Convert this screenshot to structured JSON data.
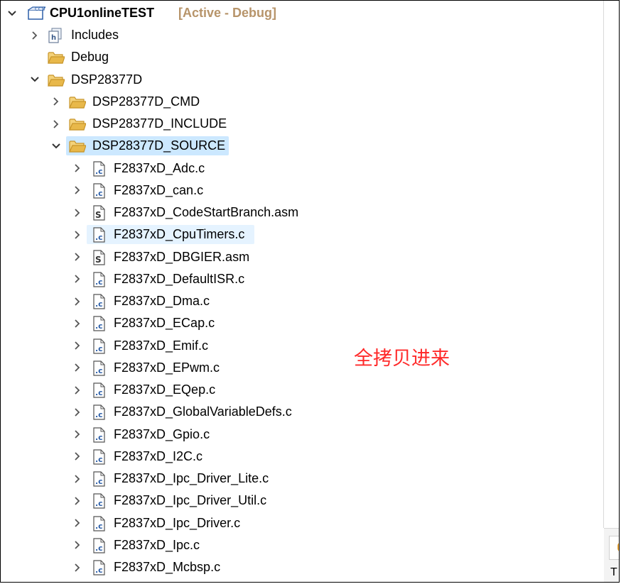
{
  "project": {
    "name": "CPU1onlineTEST",
    "state": "[Active - Debug]"
  },
  "tree": [
    {
      "label": "Includes",
      "icon": "includes-icon",
      "chevron": "collapsed",
      "depth": 1
    },
    {
      "label": "Debug",
      "icon": "folder-icon",
      "chevron": "none",
      "depth": 1
    },
    {
      "label": "DSP28377D",
      "icon": "folder-icon",
      "chevron": "expanded",
      "depth": 1
    },
    {
      "label": "DSP28377D_CMD",
      "icon": "folder-icon",
      "chevron": "collapsed",
      "depth": 2
    },
    {
      "label": "DSP28377D_INCLUDE",
      "icon": "folder-icon",
      "chevron": "collapsed",
      "depth": 2
    },
    {
      "label": "DSP28377D_SOURCE",
      "icon": "folder-icon",
      "chevron": "expanded",
      "depth": 2,
      "selected": "strong"
    },
    {
      "label": "F2837xD_Adc.c",
      "icon": "c-file-icon",
      "chevron": "collapsed",
      "depth": 3
    },
    {
      "label": "F2837xD_can.c",
      "icon": "c-file-icon",
      "chevron": "collapsed",
      "depth": 3
    },
    {
      "label": "F2837xD_CodeStartBranch.asm",
      "icon": "asm-file-icon",
      "chevron": "collapsed",
      "depth": 3
    },
    {
      "label": "F2837xD_CpuTimers.c",
      "icon": "c-file-icon",
      "chevron": "collapsed",
      "depth": 3,
      "selected": "light"
    },
    {
      "label": "F2837xD_DBGIER.asm",
      "icon": "asm-file-icon",
      "chevron": "collapsed",
      "depth": 3
    },
    {
      "label": "F2837xD_DefaultISR.c",
      "icon": "c-file-icon",
      "chevron": "collapsed",
      "depth": 3
    },
    {
      "label": "F2837xD_Dma.c",
      "icon": "c-file-icon",
      "chevron": "collapsed",
      "depth": 3
    },
    {
      "label": "F2837xD_ECap.c",
      "icon": "c-file-icon",
      "chevron": "collapsed",
      "depth": 3
    },
    {
      "label": "F2837xD_Emif.c",
      "icon": "c-file-icon",
      "chevron": "collapsed",
      "depth": 3
    },
    {
      "label": "F2837xD_EPwm.c",
      "icon": "c-file-icon",
      "chevron": "collapsed",
      "depth": 3
    },
    {
      "label": "F2837xD_EQep.c",
      "icon": "c-file-icon",
      "chevron": "collapsed",
      "depth": 3
    },
    {
      "label": "F2837xD_GlobalVariableDefs.c",
      "icon": "c-file-icon",
      "chevron": "collapsed",
      "depth": 3
    },
    {
      "label": "F2837xD_Gpio.c",
      "icon": "c-file-icon",
      "chevron": "collapsed",
      "depth": 3
    },
    {
      "label": "F2837xD_I2C.c",
      "icon": "c-file-icon",
      "chevron": "collapsed",
      "depth": 3
    },
    {
      "label": "F2837xD_Ipc_Driver_Lite.c",
      "icon": "c-file-icon",
      "chevron": "collapsed",
      "depth": 3
    },
    {
      "label": "F2837xD_Ipc_Driver_Util.c",
      "icon": "c-file-icon",
      "chevron": "collapsed",
      "depth": 3
    },
    {
      "label": "F2837xD_Ipc_Driver.c",
      "icon": "c-file-icon",
      "chevron": "collapsed",
      "depth": 3
    },
    {
      "label": "F2837xD_Ipc.c",
      "icon": "c-file-icon",
      "chevron": "collapsed",
      "depth": 3
    },
    {
      "label": "F2837xD_Mcbsp.c",
      "icon": "c-file-icon",
      "chevron": "collapsed",
      "depth": 3
    }
  ],
  "annotation": "全拷贝进来",
  "side_panel": {
    "text": "T"
  },
  "colors": {
    "selection_strong": "#cce8ff",
    "selection_light": "#e5f3ff",
    "folder": "#e8b84a",
    "annotation": "#ff2a2a",
    "project_state": "#b7946a"
  }
}
